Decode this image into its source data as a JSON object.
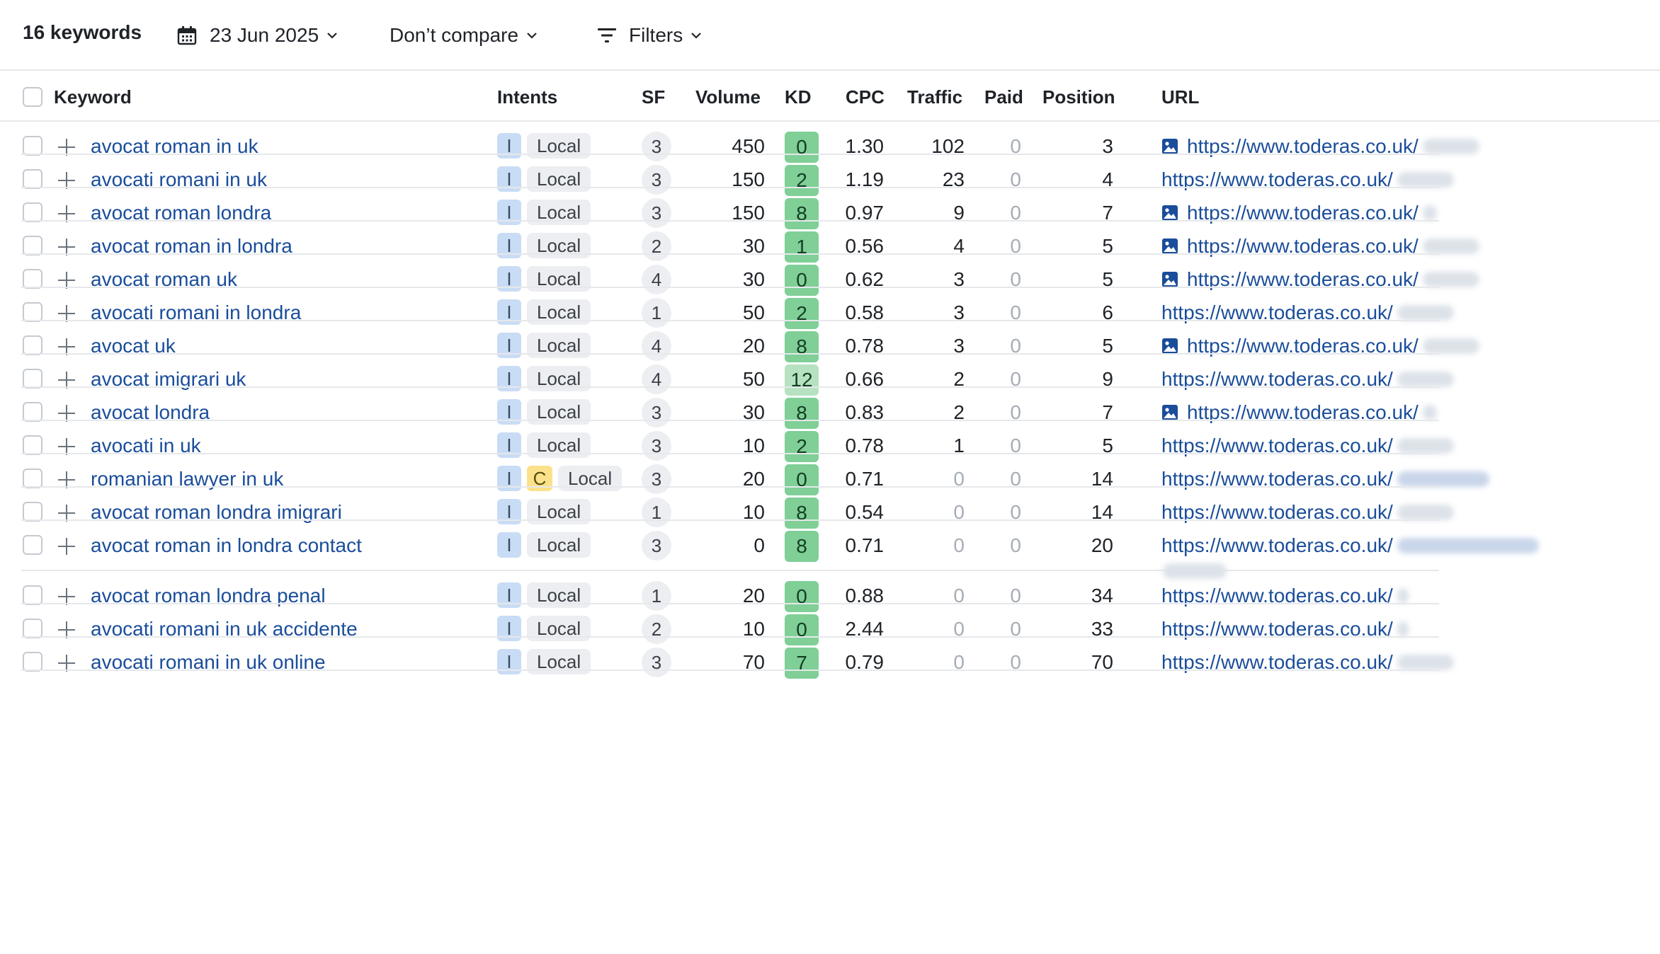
{
  "toolbar": {
    "keyword_count": "16 keywords",
    "date": "23 Jun 2025",
    "compare": "Don’t compare",
    "filters": "Filters"
  },
  "columns": {
    "keyword": "Keyword",
    "intents": "Intents",
    "sf": "SF",
    "volume": "Volume",
    "kd": "KD",
    "cpc": "CPC",
    "traffic": "Traffic",
    "paid": "Paid",
    "position": "Position",
    "url": "URL"
  },
  "colors": {
    "link": "#1a4d9a",
    "kd_easy": "#7fcf97",
    "kd_medium": "#b6e2c1",
    "intent_informational": "#c9dcf5",
    "intent_commercial": "#fbe28a"
  },
  "rows": [
    {
      "keyword": "avocat roman in uk",
      "intents": [
        "I"
      ],
      "local": "Local",
      "sf": "3",
      "volume": "450",
      "kd": "0",
      "cpc": "1.30",
      "traffic": "102",
      "paid": "0",
      "position": "3",
      "url": "https://www.toderas.co.uk/",
      "url_has_image_icon": true
    },
    {
      "keyword": "avocati romani in uk",
      "intents": [
        "I"
      ],
      "local": "Local",
      "sf": "3",
      "volume": "150",
      "kd": "2",
      "cpc": "1.19",
      "traffic": "23",
      "paid": "0",
      "position": "4",
      "url": "https://www.toderas.co.uk/",
      "url_has_image_icon": false
    },
    {
      "keyword": "avocat roman londra",
      "intents": [
        "I"
      ],
      "local": "Local",
      "sf": "3",
      "volume": "150",
      "kd": "8",
      "cpc": "0.97",
      "traffic": "9",
      "paid": "0",
      "position": "7",
      "url": "https://www.toderas.co.uk/",
      "url_has_image_icon": true
    },
    {
      "keyword": "avocat roman in londra",
      "intents": [
        "I"
      ],
      "local": "Local",
      "sf": "2",
      "volume": "30",
      "kd": "1",
      "cpc": "0.56",
      "traffic": "4",
      "paid": "0",
      "position": "5",
      "url": "https://www.toderas.co.uk/",
      "url_has_image_icon": true
    },
    {
      "keyword": "avocat roman uk",
      "intents": [
        "I"
      ],
      "local": "Local",
      "sf": "4",
      "volume": "30",
      "kd": "0",
      "cpc": "0.62",
      "traffic": "3",
      "paid": "0",
      "position": "5",
      "url": "https://www.toderas.co.uk/",
      "url_has_image_icon": true
    },
    {
      "keyword": "avocati romani in londra",
      "intents": [
        "I"
      ],
      "local": "Local",
      "sf": "1",
      "volume": "50",
      "kd": "2",
      "cpc": "0.58",
      "traffic": "3",
      "paid": "0",
      "position": "6",
      "url": "https://www.toderas.co.uk/",
      "url_has_image_icon": false
    },
    {
      "keyword": "avocat uk",
      "intents": [
        "I"
      ],
      "local": "Local",
      "sf": "4",
      "volume": "20",
      "kd": "8",
      "cpc": "0.78",
      "traffic": "3",
      "paid": "0",
      "position": "5",
      "url": "https://www.toderas.co.uk/",
      "url_has_image_icon": true
    },
    {
      "keyword": "avocat imigrari uk",
      "intents": [
        "I"
      ],
      "local": "Local",
      "sf": "4",
      "volume": "50",
      "kd": "12",
      "cpc": "0.66",
      "traffic": "2",
      "paid": "0",
      "position": "9",
      "url": "https://www.toderas.co.uk/",
      "url_has_image_icon": false
    },
    {
      "keyword": "avocat londra",
      "intents": [
        "I"
      ],
      "local": "Local",
      "sf": "3",
      "volume": "30",
      "kd": "8",
      "cpc": "0.83",
      "traffic": "2",
      "paid": "0",
      "position": "7",
      "url": "https://www.toderas.co.uk/",
      "url_has_image_icon": true
    },
    {
      "keyword": "avocati in uk",
      "intents": [
        "I"
      ],
      "local": "Local",
      "sf": "3",
      "volume": "10",
      "kd": "2",
      "cpc": "0.78",
      "traffic": "1",
      "paid": "0",
      "position": "5",
      "url": "https://www.toderas.co.uk/",
      "url_has_image_icon": false
    },
    {
      "keyword": "romanian lawyer in uk",
      "intents": [
        "I",
        "C"
      ],
      "local": "Local",
      "sf": "3",
      "volume": "20",
      "kd": "0",
      "cpc": "0.71",
      "traffic": "0",
      "paid": "0",
      "position": "14",
      "url": "https://www.toderas.co.uk/",
      "url_has_image_icon": false
    },
    {
      "keyword": "avocat roman londra imigrari",
      "intents": [
        "I"
      ],
      "local": "Local",
      "sf": "1",
      "volume": "10",
      "kd": "8",
      "cpc": "0.54",
      "traffic": "0",
      "paid": "0",
      "position": "14",
      "url": "https://www.toderas.co.uk/",
      "url_has_image_icon": false
    },
    {
      "keyword": "avocat roman in londra contact",
      "intents": [
        "I"
      ],
      "local": "Local",
      "sf": "3",
      "volume": "0",
      "kd": "8",
      "cpc": "0.71",
      "traffic": "0",
      "paid": "0",
      "position": "20",
      "url": "https://www.toderas.co.uk/",
      "url_has_image_icon": false
    },
    {
      "keyword": "avocat roman londra penal",
      "intents": [
        "I"
      ],
      "local": "Local",
      "sf": "1",
      "volume": "20",
      "kd": "0",
      "cpc": "0.88",
      "traffic": "0",
      "paid": "0",
      "position": "34",
      "url": "https://www.toderas.co.uk/",
      "url_has_image_icon": false
    },
    {
      "keyword": "avocati romani in uk accidente",
      "intents": [
        "I"
      ],
      "local": "Local",
      "sf": "2",
      "volume": "10",
      "kd": "0",
      "cpc": "2.44",
      "traffic": "0",
      "paid": "0",
      "position": "33",
      "url": "https://www.toderas.co.uk/",
      "url_has_image_icon": false
    },
    {
      "keyword": "avocati romani in uk online",
      "intents": [
        "I"
      ],
      "local": "Local",
      "sf": "3",
      "volume": "70",
      "kd": "7",
      "cpc": "0.79",
      "traffic": "0",
      "paid": "0",
      "position": "70",
      "url": "https://www.toderas.co.uk/",
      "url_has_image_icon": false
    }
  ]
}
